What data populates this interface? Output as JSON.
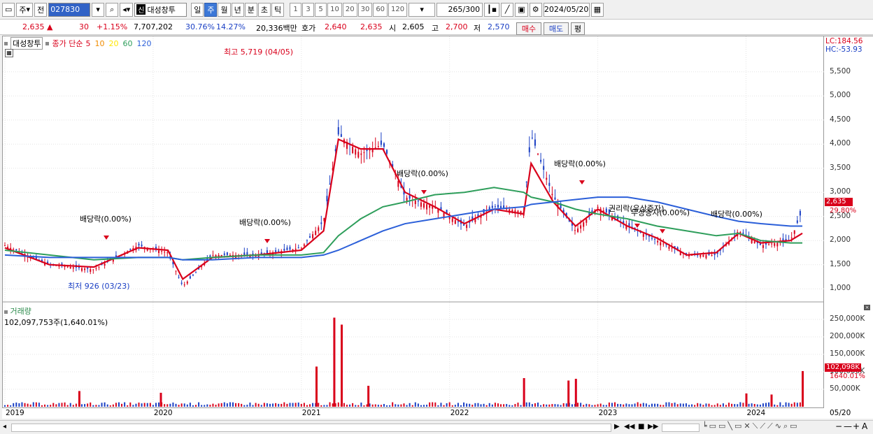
{
  "toolbar": {
    "period_label": "주",
    "prev_label": "전",
    "stock_code": "027830",
    "sin_badge": "신",
    "stock_name": "대성창투",
    "periods": [
      "일",
      "주",
      "월",
      "년",
      "분",
      "초",
      "틱"
    ],
    "selected_period": "주",
    "intervals": [
      "1",
      "3",
      "5",
      "10",
      "20",
      "30",
      "60",
      "120"
    ],
    "count_display": "265",
    "count_total": "/300",
    "date_value": "2024/05/20"
  },
  "quote": {
    "price": "2,635",
    "change_arrow": "▲",
    "change": "30",
    "change_rate": "+1.15%",
    "volume": "7,707,202",
    "rate1": "30.76%",
    "rate2": "14.27%",
    "amount": "20,336백만",
    "hoga_label": "호가",
    "hoga_sell": "2,640",
    "hoga_buy": "2,635",
    "open_label": "시",
    "open": "2,605",
    "high_label": "고",
    "high": "2,700",
    "low_label": "저",
    "low": "2,570",
    "buy_button": "매수",
    "sell_button": "매도",
    "eval_button": "평"
  },
  "price_panel": {
    "name_tag": "대성창투",
    "ma_label": "종가 단순",
    "ma_periods": [
      "5",
      "10",
      "20",
      "60",
      "120"
    ],
    "ma_colors": [
      "#d9001b",
      "#f08c00",
      "#ffe600",
      "#2e9e5b",
      "#2b5fd9"
    ],
    "lc": "LC:184.56",
    "hc": "HC:-53.93",
    "price_tag": "2,635",
    "pct_tag": "29.80%",
    "high_note": "최고 5,719 (04/05)",
    "low_note": "최저 926 (03/23)",
    "events": [
      "배당락(0.00%)",
      "배당락(0.00%)",
      "배당락(0.00%)",
      "배당락(0.00%)",
      "권리락(유상증자)",
      "배당락(0.00%)"
    ],
    "event_overlap": "무상증자(0.00%)"
  },
  "volume_panel": {
    "title": "거래량",
    "info": "102,097,753주(1,640.01%)",
    "vol_tag": "102,098K",
    "vol_pct_tag": "1640.01%"
  },
  "x_axis": {
    "labels": [
      "2019",
      "2020",
      "2021",
      "2022",
      "2023",
      "2024"
    ],
    "last_date": "05/20"
  },
  "chart_data": [
    {
      "type": "line",
      "title": "",
      "series": [
        {
          "name": "종가",
          "x": [
            2019.0,
            2019.3,
            2019.6,
            2019.9,
            2020.1,
            2020.2,
            2020.4,
            2020.7,
            2021.0,
            2021.15,
            2021.25,
            2021.4,
            2021.55,
            2021.7,
            2021.9,
            2022.1,
            2022.3,
            2022.5,
            2022.55,
            2022.7,
            2022.85,
            2023.0,
            2023.2,
            2023.4,
            2023.6,
            2023.8,
            2023.95,
            2024.1,
            2024.3,
            2024.38
          ],
          "values": [
            1900,
            1500,
            1400,
            1900,
            1750,
            1050,
            1700,
            1700,
            1850,
            2400,
            4200,
            3800,
            4000,
            2900,
            2700,
            2300,
            2700,
            2600,
            4200,
            2900,
            2200,
            2700,
            2300,
            2000,
            1700,
            1700,
            2200,
            1900,
            2000,
            2635
          ]
        },
        {
          "name": "5",
          "values": [
            1850,
            1500,
            1450,
            1850,
            1800,
            1200,
            1650,
            1700,
            1800,
            2200,
            4100,
            3900,
            3900,
            3000,
            2700,
            2350,
            2650,
            2550,
            3600,
            2800,
            2300,
            2650,
            2300,
            2050,
            1700,
            1750,
            2150,
            1950,
            2000,
            2150
          ]
        },
        {
          "name": "60",
          "values": [
            1800,
            1700,
            1600,
            1650,
            1650,
            1600,
            1650,
            1700,
            1700,
            1750,
            2100,
            2450,
            2700,
            2800,
            2950,
            3000,
            3100,
            3000,
            2900,
            2800,
            2650,
            2550,
            2450,
            2300,
            2200,
            2100,
            2150,
            2000,
            1950,
            1950
          ]
        },
        {
          "name": "120",
          "values": [
            1700,
            1650,
            1650,
            1650,
            1650,
            1600,
            1600,
            1650,
            1650,
            1700,
            1800,
            2000,
            2200,
            2350,
            2450,
            2550,
            2650,
            2700,
            2750,
            2800,
            2850,
            2900,
            2900,
            2800,
            2650,
            2500,
            2400,
            2350,
            2300,
            2300
          ]
        }
      ],
      "ylim": [
        800,
        5800
      ],
      "y_ticks": [
        "1,000",
        "1,500",
        "2,000",
        "2,500",
        "3,000",
        "3,500",
        "4,000",
        "4,500",
        "5,000",
        "5,500"
      ],
      "grid": true
    },
    {
      "type": "bar",
      "title": "거래량",
      "x": [
        2019.5,
        2020.05,
        2021.1,
        2021.22,
        2021.27,
        2021.45,
        2022.5,
        2022.8,
        2022.85,
        2024.0,
        2024.17,
        2024.38
      ],
      "values": [
        45000,
        40000,
        115000,
        255000,
        235000,
        60000,
        82000,
        75000,
        80000,
        38000,
        35000,
        102098
      ],
      "ylim": [
        0,
        270000
      ],
      "y_ticks": [
        "50,000K",
        "100,000K",
        "150,000K",
        "200,000K",
        "250,000K"
      ],
      "series_color": "#d9001b"
    }
  ]
}
